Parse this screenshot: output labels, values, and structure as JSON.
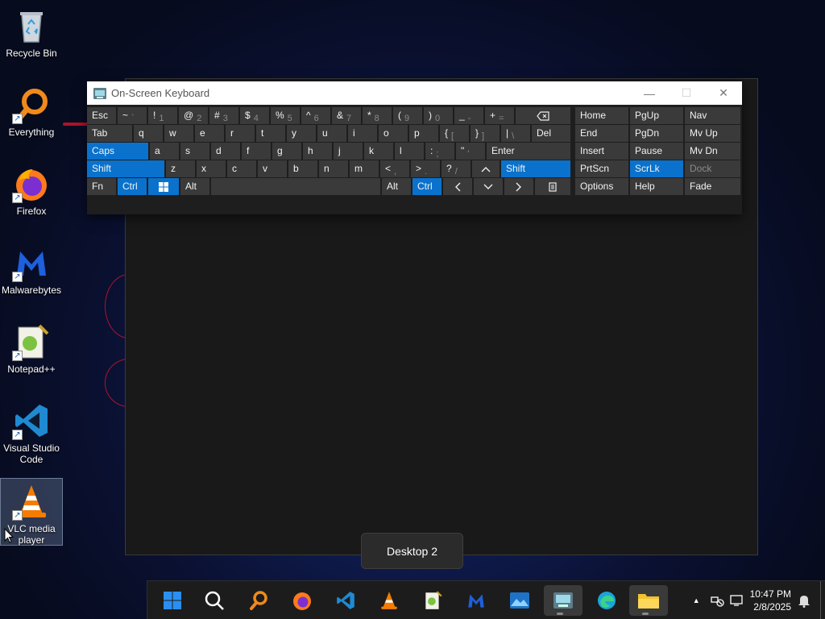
{
  "desktop": {
    "icons": [
      {
        "label": "Recycle Bin"
      },
      {
        "label": "Everything"
      },
      {
        "label": "Firefox"
      },
      {
        "label": "Malwarebytes"
      },
      {
        "label": "Notepad++"
      },
      {
        "label": "Visual Studio Code"
      },
      {
        "label": "VLC media player"
      }
    ]
  },
  "osk": {
    "title": "On-Screen Keyboard",
    "rows": [
      [
        {
          "label": "Esc"
        },
        {
          "label": "~",
          "sec": "`"
        },
        {
          "label": "!",
          "sec": "1"
        },
        {
          "label": "@",
          "sec": "2"
        },
        {
          "label": "#",
          "sec": "3"
        },
        {
          "label": "$",
          "sec": "4"
        },
        {
          "label": "%",
          "sec": "5"
        },
        {
          "label": "^",
          "sec": "6"
        },
        {
          "label": "&",
          "sec": "7"
        },
        {
          "label": "*",
          "sec": "8"
        },
        {
          "label": "(",
          "sec": "9"
        },
        {
          "label": ")",
          "sec": "0"
        },
        {
          "label": "_",
          "sec": "-"
        },
        {
          "label": "+",
          "sec": "="
        },
        {
          "label": "",
          "icon": "backspace"
        }
      ],
      [
        {
          "label": "Tab"
        },
        {
          "label": "q"
        },
        {
          "label": "w"
        },
        {
          "label": "e"
        },
        {
          "label": "r"
        },
        {
          "label": "t"
        },
        {
          "label": "y"
        },
        {
          "label": "u"
        },
        {
          "label": "i"
        },
        {
          "label": "o"
        },
        {
          "label": "p"
        },
        {
          "label": "{",
          "sec": "["
        },
        {
          "label": "}",
          "sec": "]"
        },
        {
          "label": "|",
          "sec": "\\"
        },
        {
          "label": "Del"
        }
      ],
      [
        {
          "label": "Caps",
          "active": true
        },
        {
          "label": "a"
        },
        {
          "label": "s"
        },
        {
          "label": "d"
        },
        {
          "label": "f"
        },
        {
          "label": "g"
        },
        {
          "label": "h"
        },
        {
          "label": "j"
        },
        {
          "label": "k"
        },
        {
          "label": "l"
        },
        {
          "label": ":",
          "sec": ";"
        },
        {
          "label": "\"",
          "sec": "'"
        },
        {
          "label": "Enter"
        }
      ],
      [
        {
          "label": "Shift",
          "active": true
        },
        {
          "label": "z"
        },
        {
          "label": "x"
        },
        {
          "label": "c"
        },
        {
          "label": "v"
        },
        {
          "label": "b"
        },
        {
          "label": "n"
        },
        {
          "label": "m"
        },
        {
          "label": "<",
          "sec": ","
        },
        {
          "label": ">",
          "sec": "."
        },
        {
          "label": "?",
          "sec": "/"
        },
        {
          "label": "",
          "icon": "up"
        },
        {
          "label": "Shift",
          "active": true
        }
      ],
      [
        {
          "label": "Fn"
        },
        {
          "label": "Ctrl",
          "active": true
        },
        {
          "label": "",
          "icon": "win",
          "active": true
        },
        {
          "label": "Alt"
        },
        {
          "label": ""
        },
        {
          "label": "Alt"
        },
        {
          "label": "Ctrl",
          "active": true
        },
        {
          "label": "",
          "icon": "left"
        },
        {
          "label": "",
          "icon": "down"
        },
        {
          "label": "",
          "icon": "right"
        },
        {
          "label": "",
          "icon": "menu"
        }
      ]
    ],
    "side": [
      [
        {
          "label": "Home"
        },
        {
          "label": "PgUp"
        },
        {
          "label": "Nav"
        }
      ],
      [
        {
          "label": "End"
        },
        {
          "label": "PgDn"
        },
        {
          "label": "Mv Up"
        }
      ],
      [
        {
          "label": "Insert"
        },
        {
          "label": "Pause"
        },
        {
          "label": "Mv Dn"
        }
      ],
      [
        {
          "label": "PrtScn"
        },
        {
          "label": "ScrLk",
          "active": true
        },
        {
          "label": "Dock",
          "dim": true
        }
      ],
      [
        {
          "label": "Options"
        },
        {
          "label": "Help"
        },
        {
          "label": "Fade"
        }
      ]
    ]
  },
  "tooltip": {
    "text": "Desktop 2"
  },
  "taskbar": {
    "apps": [
      "start",
      "search",
      "everything",
      "firefox",
      "vscode",
      "vlc",
      "notepad++",
      "malwarebytes",
      "photos",
      "osk",
      "edge",
      "file-explorer"
    ],
    "time": "10:47 PM",
    "date": "2/8/2025"
  }
}
